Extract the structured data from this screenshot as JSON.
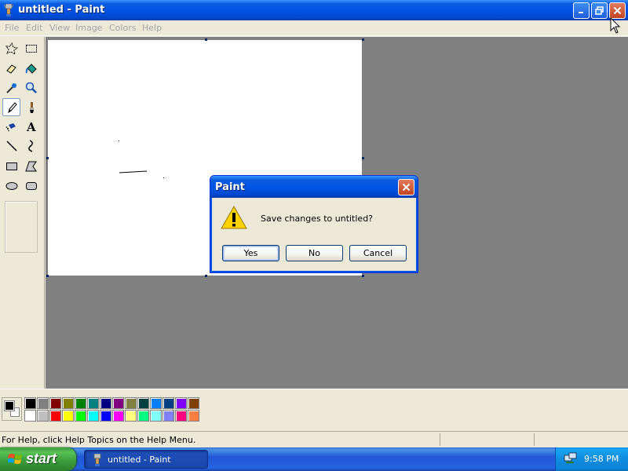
{
  "window": {
    "title": "untitled - Paint",
    "app_icon": "paint-brush-icon"
  },
  "menu": {
    "items": [
      "File",
      "Edit",
      "View",
      "Image",
      "Colors",
      "Help"
    ]
  },
  "toolbox": {
    "tools": [
      "free-form-select-icon",
      "rect-select-icon",
      "eraser-icon",
      "fill-bucket-icon",
      "color-picker-icon",
      "magnifier-icon",
      "pencil-icon",
      "brush-icon",
      "airbrush-icon",
      "text-icon",
      "line-icon",
      "curve-icon",
      "rectangle-icon",
      "polygon-icon",
      "ellipse-icon",
      "rounded-rect-icon"
    ],
    "selected_tool": "pencil-icon"
  },
  "palette": {
    "foreground": "#000000",
    "background": "#ffffff",
    "row1": [
      "#000000",
      "#808080",
      "#800000",
      "#808000",
      "#008000",
      "#008080",
      "#000080",
      "#800080",
      "#808040",
      "#004040",
      "#0080ff",
      "#004080",
      "#8000ff",
      "#804000"
    ],
    "row2": [
      "#ffffff",
      "#c0c0c0",
      "#ff0000",
      "#ffff00",
      "#00ff00",
      "#00ffff",
      "#0000ff",
      "#ff00ff",
      "#ffff80",
      "#00ff80",
      "#80ffff",
      "#8080ff",
      "#ff0080",
      "#ff8040"
    ]
  },
  "status": {
    "help_text": "For Help, click Help Topics on the Help Menu."
  },
  "dialog": {
    "title": "Paint",
    "message": "Save changes to untitled?",
    "yes_label": "Yes",
    "no_label": "No",
    "cancel_label": "Cancel"
  },
  "taskbar": {
    "start_label": "start",
    "task_label": "untitled - Paint",
    "clock": "9:58 PM"
  },
  "colors": {
    "titlebar": "#0054e3",
    "workspace": "#808080",
    "chrome": "#ece9d8"
  }
}
